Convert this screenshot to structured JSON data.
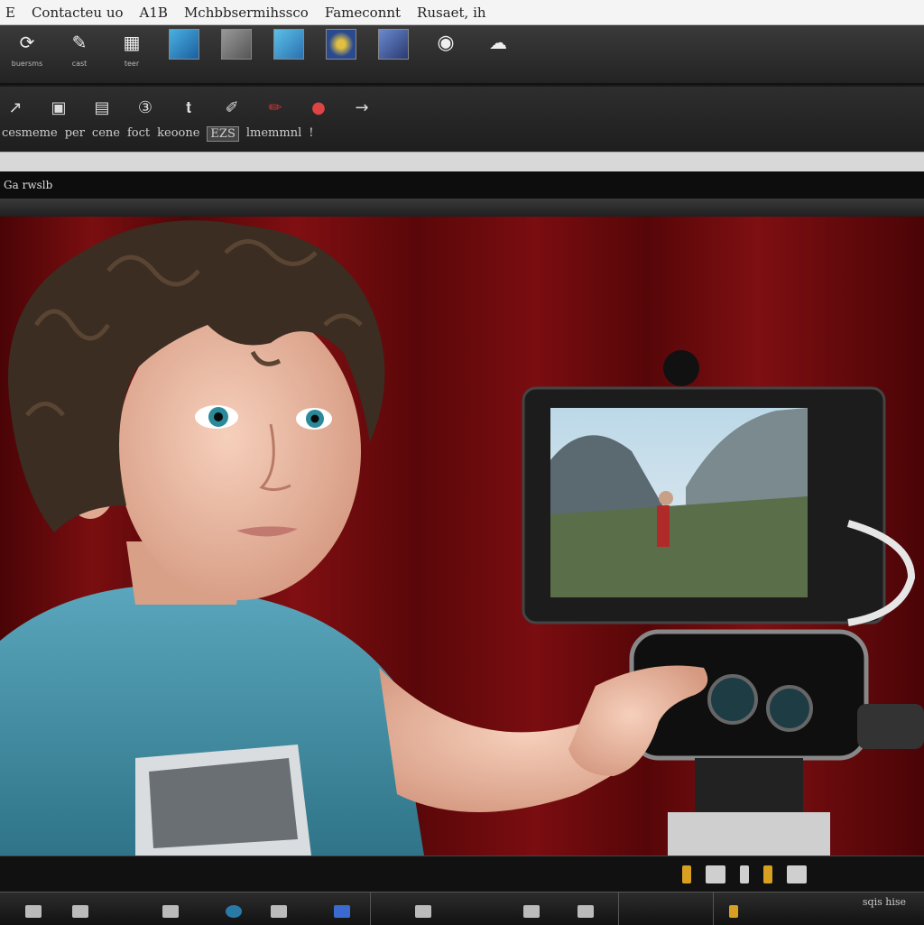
{
  "titlebar": {
    "items": [
      "E",
      "Contacteu uo",
      "A1B",
      "Mchbbsermihssco",
      "Fameconnt",
      "Rusaet, ih"
    ]
  },
  "toolbar1": {
    "items": [
      {
        "icon": "refresh-icon",
        "label": "buersms"
      },
      {
        "icon": "edit-icon",
        "label": "cast"
      },
      {
        "icon": "grid-icon",
        "label": "teer"
      },
      {
        "icon": "image-icon",
        "label": ""
      },
      {
        "icon": "image-icon",
        "label": ""
      },
      {
        "icon": "image-icon",
        "label": ""
      },
      {
        "icon": "image-icon",
        "label": ""
      },
      {
        "icon": "image-icon",
        "label": ""
      },
      {
        "icon": "circle-icon",
        "label": ""
      },
      {
        "icon": "cloud-icon",
        "label": ""
      }
    ]
  },
  "toolbar2": {
    "icons": [
      "cursor-icon",
      "grid-icon",
      "grid-icon",
      "number-icon",
      "text-icon",
      "brush-icon",
      "pen-icon",
      "apple-icon",
      "arrow-icon"
    ],
    "labels": [
      "cesmeme",
      "per",
      "cene",
      "foct",
      "keoone",
      "EZS",
      "lmemmnl",
      "!"
    ]
  },
  "panel": {
    "title": "Ga",
    "subtitle": "rwslb"
  },
  "viewport": {
    "background_color": "#6a0a0c",
    "scene": "boy-with-camera"
  },
  "timeline": {
    "right_label": "sqis hise"
  }
}
